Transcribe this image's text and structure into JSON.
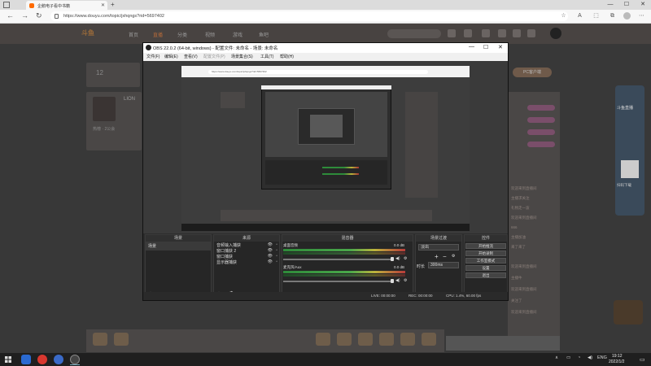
{
  "browser": {
    "tab_title": "企鹅电子看中书籍",
    "url": "https://www.douyu.com/topic/jxhqngs?rid=5697402"
  },
  "site": {
    "logo": "斗鱼",
    "nav": [
      "首页",
      "直播",
      "分类",
      "视频",
      "游戏",
      "鱼吧"
    ],
    "rank_number": "12",
    "streamer_name": "LION",
    "streamer_tag": "热榜 · 2公会",
    "pc_button": "PC客户端",
    "chat_lines": [
      "欢迎来到直播间",
      "主播求关注",
      "礼物走一波",
      "欢迎来到直播间",
      "666",
      "主播加油",
      "来了来了",
      "欢迎来到直播间",
      "主播牛",
      "欢迎来到直播间",
      "关注了",
      "欢迎来到直播间"
    ],
    "ad_title": "斗鱼直播",
    "qr_caption": "扫码下载"
  },
  "obs": {
    "title": "OBS 22.0.2 (64-bit, windows) - 配置文件: 未命名 - 场景: 未命名",
    "menu": [
      "文件(F)",
      "编辑(E)",
      "查看(V)",
      "配置文件(P)",
      "场景集合(S)",
      "工具(T)",
      "帮助(H)"
    ],
    "nested_url": "https://www.douyu.com/topic/jxhqngs?rid=5697402",
    "docks": {
      "scenes": "场景",
      "sources": "来源",
      "mixer": "混音器",
      "transitions": "场景过渡",
      "controls": "控件"
    },
    "scenes": [
      "场景"
    ],
    "sources": [
      "音频输入捕获",
      "窗口捕获 2",
      "窗口捕获",
      "显示器捕获"
    ],
    "mixer": [
      {
        "label": "桌面音频",
        "db": "0.0 dB"
      },
      {
        "label": "麦克风/Aux",
        "db": "0.0 dB"
      }
    ],
    "transition": {
      "mode": "淡出",
      "duration_label": "时长",
      "duration": "300ms"
    },
    "controls": [
      "开始推流",
      "开始录制",
      "工作室模式",
      "设置",
      "退出"
    ],
    "status": {
      "live": "LIVE: 00:00:00",
      "rec": "REC: 00:00:00",
      "cpu": "CPU: 1.4%, 60.00 fps"
    }
  },
  "taskbar": {
    "lang": "ENG",
    "time": "19:12",
    "date": "2022/1/2"
  }
}
